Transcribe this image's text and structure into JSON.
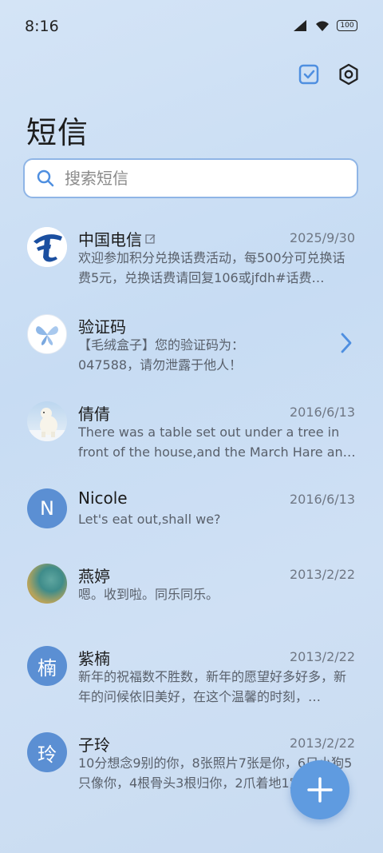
{
  "status": {
    "time": "8:16",
    "battery": "100"
  },
  "header": {
    "title": "短信"
  },
  "search": {
    "placeholder": "搜索短信"
  },
  "colors": {
    "accent": "#5f9be0",
    "background": "#cfe0f4"
  },
  "messages": [
    {
      "name": "中国电信",
      "date": "2025/9/30",
      "preview": "欢迎参加积分兑换话费活动，每500分可兑换话费5元，兑换话费请回复106或jfdh#话费…",
      "avatar": "china-telecom-logo"
    },
    {
      "name": "验证码",
      "date": "",
      "preview": "【毛绒盒子】您的验证码为：047588，请勿泄露于他人！",
      "avatar": "butterfly-avatar"
    },
    {
      "name": "倩倩",
      "date": "2016/6/13",
      "preview": "There was a table set out under a tree in front of the house,and the March Hare an…",
      "avatar": "polar-bear-avatar"
    },
    {
      "name": "Nicole",
      "date": "2016/6/13",
      "preview": "Let's eat out,shall we?",
      "avatar": "N"
    },
    {
      "name": "燕婷",
      "date": "2013/2/22",
      "preview": "嗯。收到啦。同乐同乐。",
      "avatar": "landscape-avatar"
    },
    {
      "name": "紫楠",
      "date": "2013/2/22",
      "preview": "新年的祝福数不胜数，新年的愿望好多好多，新年的问候依旧美好，在这个温馨的时刻，…",
      "avatar": "楠"
    },
    {
      "name": "子玲",
      "date": "2013/2/22",
      "preview": "10分想念9别的你，8张照片7张是你，6只小狗5只像你，4根骨头3根归你，2爪着地1宝…",
      "avatar": "玲"
    }
  ]
}
